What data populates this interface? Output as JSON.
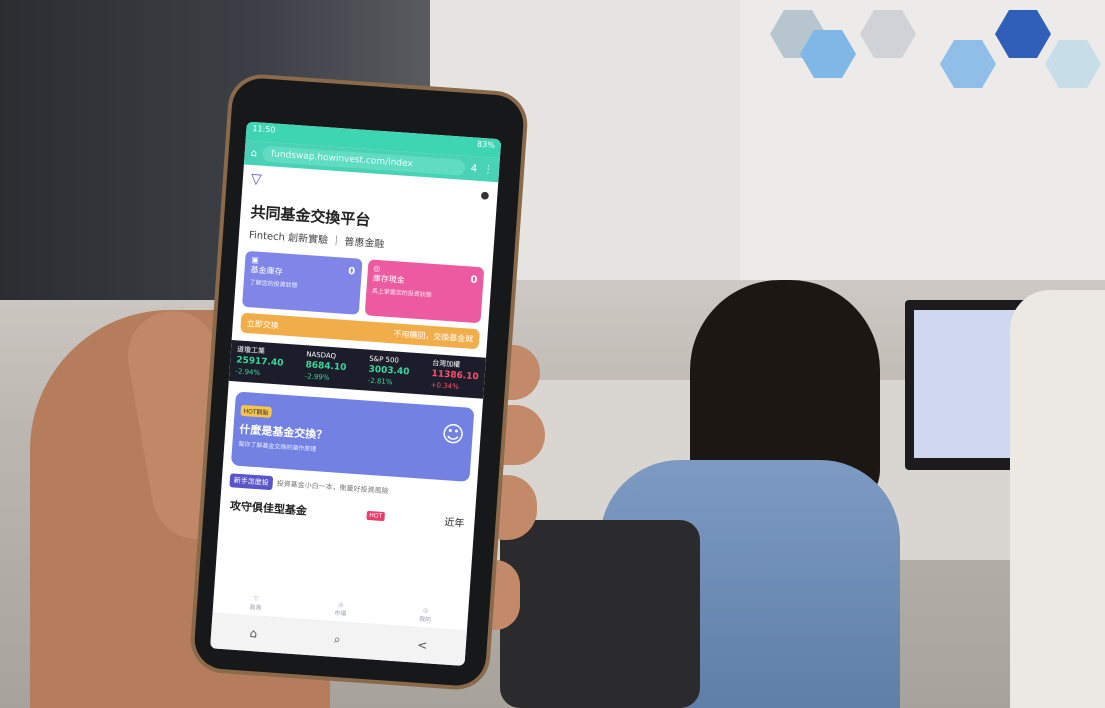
{
  "status": {
    "time": "11:50",
    "battery": "83%"
  },
  "browser": {
    "url": "fundswap.howinvest.com/index",
    "tab_count": "4",
    "nav_home": "⌂",
    "nav_search": "⌕",
    "nav_share": "<"
  },
  "app": {
    "title": "共同基金交換平台",
    "subtitle": "Fintech 創新實驗 ｜ 普惠金融",
    "card_holdings": {
      "label": "基金庫存",
      "desc": "了解您的投資狀態",
      "value": "0"
    },
    "card_cash": {
      "label": "庫存現金",
      "desc": "馬上掌握您的投資狀態",
      "value": "0"
    },
    "instant_swap": {
      "label": "立即交換",
      "desc": "不用贖回，交換基金就"
    },
    "tickers": [
      {
        "name": "道瓊工業",
        "value": "25917.40",
        "change": "-2.94%",
        "color": "green"
      },
      {
        "name": "NASDAQ",
        "value": "8684.10",
        "change": "-2.99%",
        "color": "green"
      },
      {
        "name": "S&P 500",
        "value": "3003.40",
        "change": "-2.81%",
        "color": "green"
      },
      {
        "name": "台灣加權",
        "value": "11386.10",
        "change": "+0.34%",
        "color": "red"
      }
    ],
    "banner": {
      "tag": "HOT觀點",
      "question": "什麼是基金交換？",
      "desc": "幫你了解基金交換的運作原理"
    },
    "guide": {
      "label": "新手怎麼投",
      "desc": "投資基金小白一本，衡量好投資風險"
    },
    "fund": {
      "title": "攻守俱佳型基金",
      "hot": "HOT",
      "near": "近年"
    },
    "nav": [
      "首頁",
      "市場",
      "我的"
    ]
  },
  "colors": {
    "accent": "#49d2b5",
    "brand": "#5a56c8",
    "card_a": "#7f86e8",
    "card_b": "#ec5aa0",
    "instant": "#f2ad4b"
  }
}
